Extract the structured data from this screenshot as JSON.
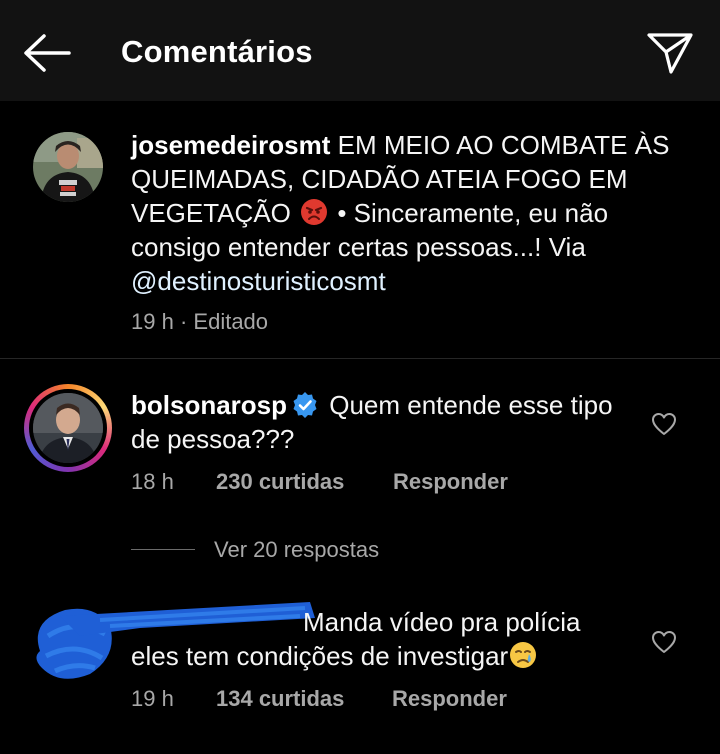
{
  "header": {
    "title": "Comentários",
    "back_icon": "arrow-left-icon",
    "send_icon": "paper-plane-icon"
  },
  "caption": {
    "username": "josemedeirosmt",
    "text_part1": " EM MEIO AO COMBATE ÀS QUEIMADAS, CIDADÃO ATEIA FOGO EM VEGETAÇÃO",
    "emoji": "angry-face-emoji",
    "text_part2": " • Sinceramente, eu não consigo entender certas pessoas...! Via ",
    "mention": "@destinosturisticosmt",
    "time": "19 h",
    "separator": "·",
    "edited": "Editado"
  },
  "comments": [
    {
      "username": "bolsonarosp",
      "verified": true,
      "text": " Quem entende esse tipo de pessoa???",
      "time": "18 h",
      "likes": "230 curtidas",
      "reply": "Responder",
      "view_replies": "Ver 20 respostas"
    },
    {
      "username": "",
      "redacted": true,
      "text": "Manda vídeo pra polícia eles tem condições de investigar",
      "emoji": "crying-face-emoji",
      "time": "19 h",
      "likes": "134 curtidas",
      "reply": "Responder"
    }
  ],
  "colors": {
    "background": "#000000",
    "header": "#121212",
    "text": "#f5f5f5",
    "secondary": "#a8a8a8",
    "verified": "#3897f0",
    "redaction": "#1f5fd6"
  }
}
